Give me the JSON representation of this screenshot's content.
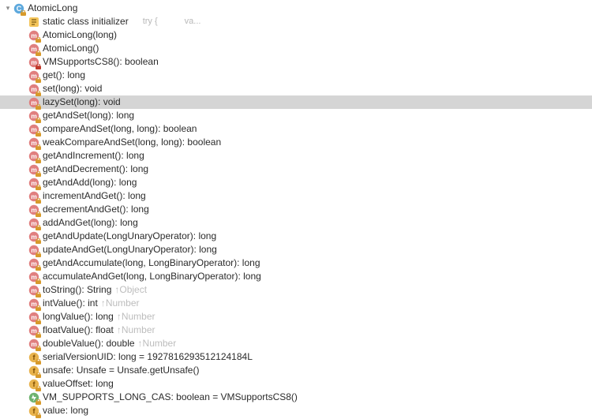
{
  "class_header": {
    "name": "AtomicLong",
    "lock": false
  },
  "static_init": {
    "label": "static class initializer",
    "code_hint1": "try {",
    "code_hint2": "va..."
  },
  "members": [
    {
      "icon": "method",
      "lock": true,
      "label": "AtomicLong(long)",
      "inherit": ""
    },
    {
      "icon": "method",
      "lock": true,
      "label": "AtomicLong()",
      "inherit": ""
    },
    {
      "icon": "method",
      "lock": true,
      "label": "VMSupportsCS8(): boolean",
      "inherit": "",
      "private": true
    },
    {
      "icon": "method",
      "lock": true,
      "label": "get(): long",
      "inherit": ""
    },
    {
      "icon": "method",
      "lock": true,
      "label": "set(long): void",
      "inherit": ""
    },
    {
      "icon": "method",
      "lock": true,
      "label": "lazySet(long): void",
      "inherit": "",
      "selected": true
    },
    {
      "icon": "method",
      "lock": true,
      "label": "getAndSet(long): long",
      "inherit": ""
    },
    {
      "icon": "method",
      "lock": true,
      "label": "compareAndSet(long, long): boolean",
      "inherit": ""
    },
    {
      "icon": "method",
      "lock": true,
      "label": "weakCompareAndSet(long, long): boolean",
      "inherit": ""
    },
    {
      "icon": "method",
      "lock": true,
      "label": "getAndIncrement(): long",
      "inherit": ""
    },
    {
      "icon": "method",
      "lock": true,
      "label": "getAndDecrement(): long",
      "inherit": ""
    },
    {
      "icon": "method",
      "lock": true,
      "label": "getAndAdd(long): long",
      "inherit": ""
    },
    {
      "icon": "method",
      "lock": true,
      "label": "incrementAndGet(): long",
      "inherit": ""
    },
    {
      "icon": "method",
      "lock": true,
      "label": "decrementAndGet(): long",
      "inherit": ""
    },
    {
      "icon": "method",
      "lock": true,
      "label": "addAndGet(long): long",
      "inherit": ""
    },
    {
      "icon": "method",
      "lock": true,
      "label": "getAndUpdate(LongUnaryOperator): long",
      "inherit": ""
    },
    {
      "icon": "method",
      "lock": true,
      "label": "updateAndGet(LongUnaryOperator): long",
      "inherit": ""
    },
    {
      "icon": "method",
      "lock": true,
      "label": "getAndAccumulate(long, LongBinaryOperator): long",
      "inherit": ""
    },
    {
      "icon": "method",
      "lock": true,
      "label": "accumulateAndGet(long, LongBinaryOperator): long",
      "inherit": ""
    },
    {
      "icon": "method",
      "lock": true,
      "label": "toString(): String",
      "inherit": "↑Object"
    },
    {
      "icon": "method",
      "lock": true,
      "label": "intValue(): int",
      "inherit": "↑Number"
    },
    {
      "icon": "method",
      "lock": true,
      "label": "longValue(): long",
      "inherit": "↑Number"
    },
    {
      "icon": "method",
      "lock": true,
      "label": "floatValue(): float",
      "inherit": "↑Number"
    },
    {
      "icon": "method",
      "lock": true,
      "label": "doubleValue(): double",
      "inherit": "↑Number"
    },
    {
      "icon": "field",
      "lock": true,
      "label": "serialVersionUID: long = 1927816293512124184L",
      "inherit": ""
    },
    {
      "icon": "field",
      "lock": true,
      "label": "unsafe: Unsafe = Unsafe.getUnsafe()",
      "inherit": ""
    },
    {
      "icon": "field",
      "lock": true,
      "label": "valueOffset: long",
      "inherit": ""
    },
    {
      "icon": "field",
      "lock": true,
      "label": "VM_SUPPORTS_LONG_CAS: boolean = VMSupportsCS8()",
      "inherit": "",
      "special": true
    },
    {
      "icon": "field",
      "lock": true,
      "label": "value: long",
      "inherit": ""
    }
  ]
}
